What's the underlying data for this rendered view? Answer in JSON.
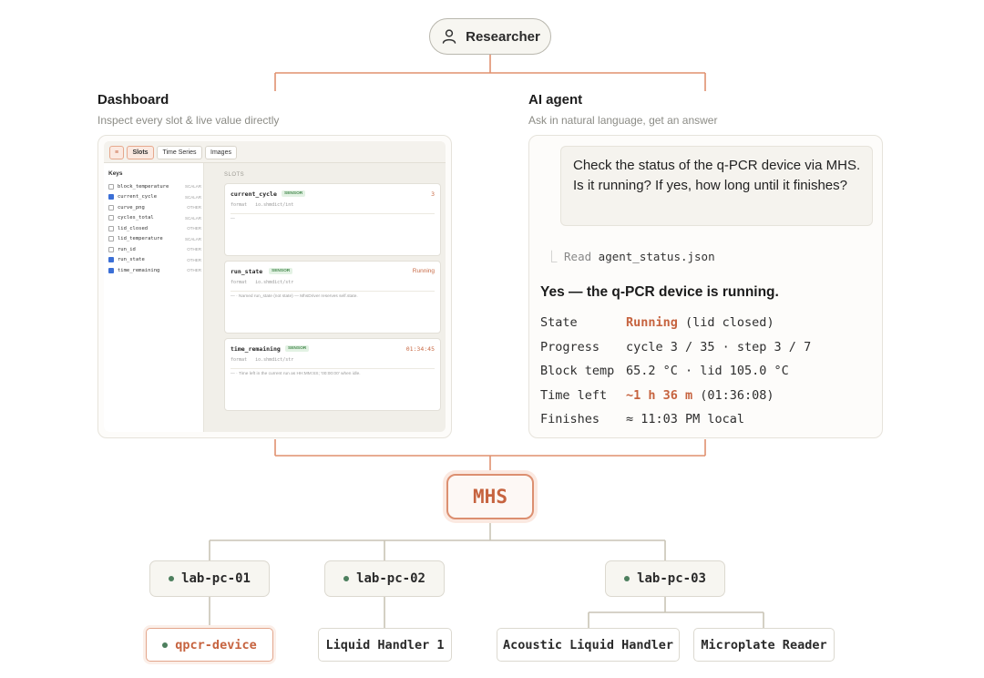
{
  "researcher": {
    "label": "Researcher",
    "icon": "person-icon"
  },
  "dashboard": {
    "title": "Dashboard",
    "subtitle": "Inspect every slot & live value directly",
    "tabs": [
      "Slots",
      "Time Series",
      "Images"
    ],
    "keys_title": "Keys",
    "keys": [
      {
        "name": "block_temperature",
        "kind": "SCALAR",
        "checked": false
      },
      {
        "name": "current_cycle",
        "kind": "SCALAR",
        "checked": true
      },
      {
        "name": "curve_png",
        "kind": "OTHER",
        "checked": false
      },
      {
        "name": "cycles_total",
        "kind": "SCALAR",
        "checked": false
      },
      {
        "name": "lid_closed",
        "kind": "OTHER",
        "checked": false
      },
      {
        "name": "lid_temperature",
        "kind": "SCALAR",
        "checked": false
      },
      {
        "name": "run_id",
        "kind": "OTHER",
        "checked": false
      },
      {
        "name": "run_state",
        "kind": "OTHER",
        "checked": true
      },
      {
        "name": "time_remaining",
        "kind": "OTHER",
        "checked": true
      }
    ],
    "slots_title": "SLOTS",
    "slots": [
      {
        "name": "current_cycle",
        "badge": "SENSOR",
        "value": "3",
        "format_label": "format",
        "format": "io.shmdict/int",
        "note": "—"
      },
      {
        "name": "run_state",
        "badge": "SENSOR",
        "value": "Running",
        "format_label": "format",
        "format": "io.shmdict/str",
        "note": "— · Named run_state (not state) — MhsDriver reserves self.state."
      },
      {
        "name": "time_remaining",
        "badge": "SENSOR",
        "value": "01:34:45",
        "format_label": "format",
        "format": "io.shmdict/str",
        "note": "— · Time left in the current run as HH:MM:SS; '00:00:00' when idle."
      }
    ]
  },
  "agent": {
    "title": "AI agent",
    "subtitle": "Ask in natural language, get an answer",
    "question": "Check the status of the q-PCR device via MHS. Is it running? If yes, how long until it finishes?",
    "read_verb": "Read",
    "read_file": "agent_status.json",
    "answer": "Yes — the q-PCR device is running.",
    "rows": [
      {
        "key": "State",
        "accent": "Running",
        "rest": " (lid closed)"
      },
      {
        "key": "Progress",
        "accent": "",
        "rest": "cycle 3 / 35 · step 3 / 7"
      },
      {
        "key": "Block temp",
        "accent": "",
        "rest": "65.2 °C · lid 105.0 °C"
      },
      {
        "key": "Time left",
        "accent": "~1 h 36 m",
        "rest": " (01:36:08)"
      },
      {
        "key": "Finishes",
        "accent": "",
        "rest": "≈ 11:03 PM local"
      }
    ]
  },
  "hub": {
    "label": "MHS"
  },
  "pcs": [
    "lab-pc-01",
    "lab-pc-02",
    "lab-pc-03"
  ],
  "devices": [
    "qpcr-device",
    "Liquid Handler 1",
    "Acoustic Liquid Handler",
    "Microplate Reader"
  ],
  "colors": {
    "accent": "#c6633f",
    "connector_top": "#e0906f",
    "connector_bottom": "#c9c4b5",
    "status_dot": "#4d7f5e"
  }
}
